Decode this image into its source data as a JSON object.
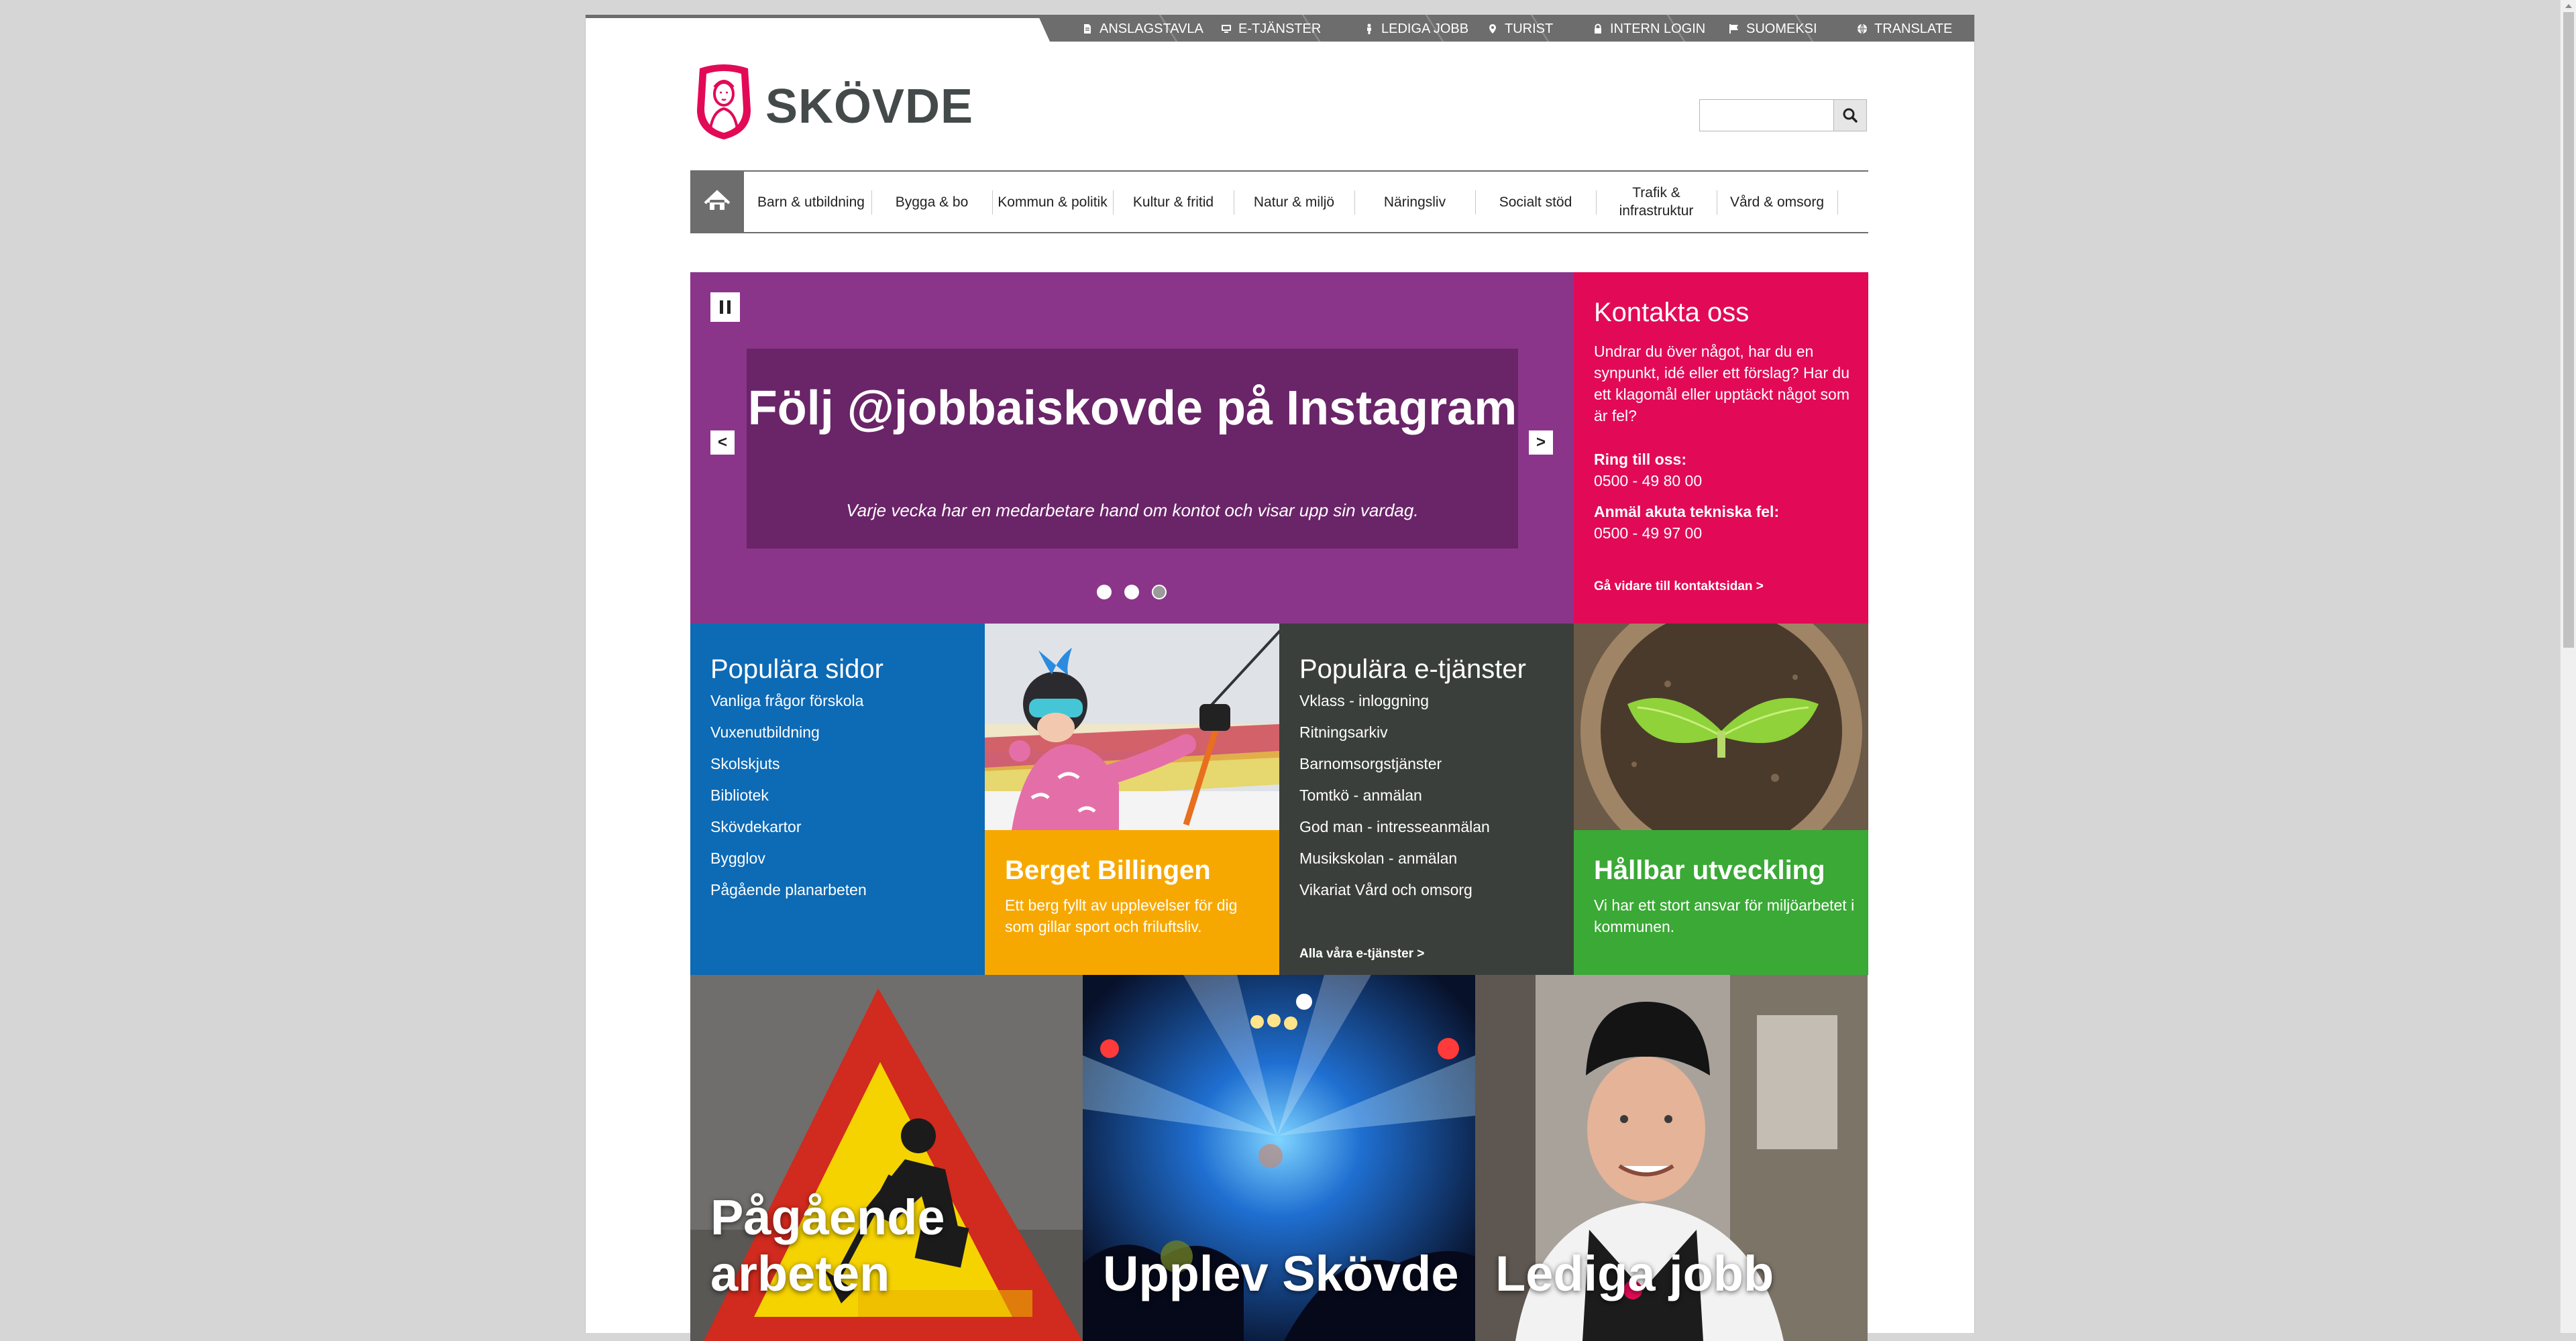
{
  "topbar": {
    "items": [
      "ANSLAGSTAVLA",
      "E-TJÄNSTER",
      "LEDIGA JOBB",
      "TURIST",
      "INTERN LOGIN",
      "SUOMEKSI",
      "TRANSLATE"
    ]
  },
  "logo": {
    "text": "SKÖVDE"
  },
  "search": {
    "placeholder": ""
  },
  "nav": {
    "items": [
      "Barn & utbildning",
      "Bygga & bo",
      "Kommun & politik",
      "Kultur & fritid",
      "Natur & miljö",
      "Näringsliv",
      "Socialt stöd",
      "Trafik & infrastruktur",
      "Vård & omsorg"
    ]
  },
  "hero": {
    "title": "Följ @jobbaiskovde på Instagram",
    "subtitle": "Varje vecka har en medarbetare hand om kontot och visar upp sin vardag.",
    "prev": "<",
    "next": ">",
    "slides": 3,
    "active_slide": 3
  },
  "contact": {
    "title": "Kontakta oss",
    "text": "Undrar du över något, har du en synpunkt, idé eller ett förslag? Har du ett klagomål eller upptäckt något som är fel?",
    "phone_label": "Ring till oss:",
    "phone": "0500 - 49 80 00",
    "tech_label": "Anmäl akuta tekniska fel:",
    "tech_phone": "0500 - 49 97 00",
    "link": "Gå vidare till kontaktsidan  >"
  },
  "popular_pages": {
    "title": "Populära sidor",
    "links": [
      "Vanliga frågor förskola",
      "Vuxenutbildning",
      "Skolskjuts",
      "Bibliotek",
      "Skövdekartor",
      "Bygglov",
      "Pågående planarbeten"
    ]
  },
  "billingen": {
    "title": "Berget Billingen",
    "text": "Ett berg fyllt av upplevelser för dig som gillar sport och friluftsliv."
  },
  "eservices": {
    "title": "Populära e-tjänster",
    "links": [
      "Vklass - inloggning",
      "Ritningsarkiv",
      "Barnomsorgstjänster",
      "Tomtkö - anmälan",
      "God man - intresseanmälan",
      "Musikskolan - anmälan",
      "Vikariat Vård och omsorg"
    ],
    "all_link": "Alla våra e-tjänster  >"
  },
  "sustainable": {
    "title": "Hållbar utveckling",
    "text": "Vi har ett stort ansvar för miljöarbetet i kommunen."
  },
  "big_tiles": {
    "works": "Pågående arbeten",
    "experience": "Upplev Skövde",
    "jobs": "Lediga jobb"
  },
  "colors": {
    "purple": "#8b358a",
    "pink": "#e20a56",
    "blue": "#0d6ab5",
    "orange": "#f7a800",
    "dark": "#3b3f3c",
    "green": "#3aa935",
    "grey": "#6d6d6d"
  },
  "icons": {
    "topbar": [
      "document-icon",
      "monitor-icon",
      "person-icon",
      "map-pin-icon",
      "lock-icon",
      "flag-icon",
      "globe-icon"
    ],
    "search": "search-icon",
    "home": "home-icon",
    "pause": "pause-icon"
  }
}
